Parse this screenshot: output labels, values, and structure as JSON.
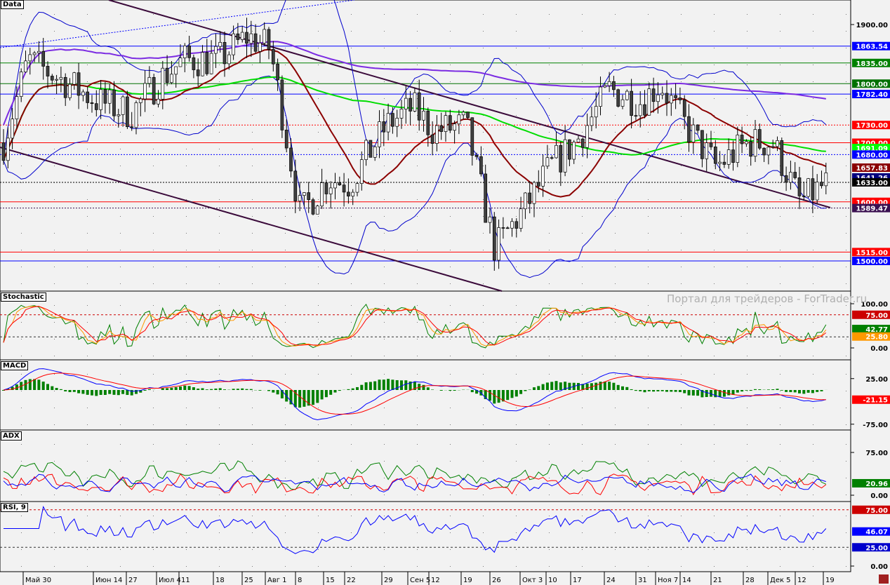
{
  "panels": {
    "main": "Data",
    "stoch": "Stochastic",
    "macd": "MACD",
    "adx": "ADX",
    "rsi": "RSI, 9"
  },
  "watermark": "Портал для трейдеров - ForTrader.ru",
  "chart_data": {
    "type": "candlestick",
    "x_labels": [
      "Май 30",
      "Июн 14",
      "27",
      "Июл 4",
      "11",
      "18",
      "25",
      "Авг 1",
      "8",
      "15",
      "22",
      "29",
      "Сен 5",
      "12",
      "19",
      "26",
      "Окт 3",
      "10",
      "17",
      "24",
      "31",
      "Ноя 7",
      "14",
      "21",
      "28",
      "Дек 5",
      "12",
      "19"
    ],
    "close_keypoints": [
      1840,
      1770,
      1750,
      1810,
      1840,
      1840,
      1880,
      1860,
      1580,
      1640,
      1630,
      1730,
      1760,
      1720,
      1730,
      1520,
      1590,
      1660,
      1700,
      1790,
      1770,
      1800,
      1730,
      1660,
      1700,
      1700,
      1600,
      1633
    ],
    "price_ticks": [
      "1900.00"
    ],
    "price_range": [
      1400,
      1942
    ],
    "levels": [
      {
        "label": "1863.54",
        "value": 1863.54,
        "color": "#0000ff",
        "style": "solid"
      },
      {
        "label": "1835.00",
        "value": 1835,
        "color": "#008000",
        "style": "solid"
      },
      {
        "label": "1800.00",
        "value": 1800,
        "color": "#007000",
        "style": "solid"
      },
      {
        "label": "1782.40",
        "value": 1782.4,
        "color": "#0000ff",
        "style": "solid"
      },
      {
        "label": "1730.00",
        "value": 1730,
        "color": "#ff0000",
        "style": "dotted"
      },
      {
        "label": "1700.00",
        "value": 1700,
        "color": "#ff0000",
        "style": "solid"
      },
      {
        "label": "1691.09",
        "value": 1691.09,
        "color": "#00ff00",
        "style": "none"
      },
      {
        "label": "1680.00",
        "value": 1680,
        "color": "#0000ff",
        "style": "dotted"
      },
      {
        "label": "1657.83",
        "value": 1657.83,
        "color": "#8b0000",
        "style": "none"
      },
      {
        "label": "1641.26",
        "value": 1641.26,
        "color": "#000080",
        "style": "none"
      },
      {
        "label": "1633.00",
        "value": 1633,
        "color": "#000000",
        "style": "dotted"
      },
      {
        "label": "1600.00",
        "value": 1600,
        "color": "#ff0000",
        "style": "solid"
      },
      {
        "label": "1589.47",
        "value": 1589.47,
        "color": "#3a1050",
        "style": "dotted"
      },
      {
        "label": "1515.00",
        "value": 1515,
        "color": "#ff0000",
        "style": "solid"
      },
      {
        "label": "1500.00",
        "value": 1500,
        "color": "#0000ff",
        "style": "solid"
      }
    ],
    "stochastic": {
      "ticks": [
        "100.00",
        "0.00"
      ],
      "levels": [
        {
          "label": "75.00",
          "color": "#cc0000"
        },
        {
          "label": "42.77",
          "color": "#008000"
        },
        {
          "label": "25.80",
          "color": "#ff9900"
        }
      ]
    },
    "macd": {
      "ticks": [
        "25.00",
        "-75.00"
      ],
      "levels": [
        {
          "label": "-21.15",
          "color": "#ff0000"
        }
      ]
    },
    "adx": {
      "ticks": [
        "75.00",
        "0.00"
      ],
      "levels": [
        {
          "label": "20.96",
          "color": "#008000"
        }
      ]
    },
    "rsi": {
      "ticks": [
        "0.00"
      ],
      "levels": [
        {
          "label": "75.00",
          "color": "#cc0000"
        },
        {
          "label": "46.07",
          "color": "#0000ff"
        },
        {
          "label": "25.00",
          "color": "#0000cc"
        }
      ]
    }
  }
}
